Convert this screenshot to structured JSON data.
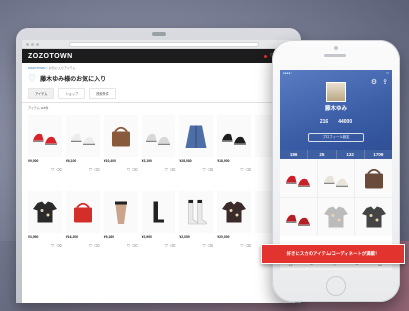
{
  "browser": {
    "address": ""
  },
  "site": {
    "logo": "ZOZOTOWN",
    "header_user": "",
    "breadcrumb_home": "ZOZOTOWN",
    "breadcrumb_current": "> お気に入りアイテム",
    "page_title": "藤木ゆみ様のお気に入り",
    "tabs": [
      {
        "label": "アイテム"
      },
      {
        "label": "ショップ"
      },
      {
        "label": "検索条件"
      }
    ],
    "tab_link": "",
    "filters": {
      "count_label": "アイテム 118件",
      "sort": "",
      "shop": "",
      "category": "",
      "price": "",
      "stock": ""
    }
  },
  "products": [
    {
      "price": "¥9,000",
      "meta": "",
      "shape": "shoes",
      "color": "#d9232a"
    },
    {
      "price": "¥6,100",
      "meta": "",
      "shape": "shoes",
      "color": "#ededed"
    },
    {
      "price": "¥10,400",
      "meta": "",
      "shape": "bag",
      "color": "#8a5a3c"
    },
    {
      "price": "¥3,190",
      "meta": "",
      "shape": "shoes",
      "color": "#d8d8d8"
    },
    {
      "price": "¥28,080",
      "meta": "",
      "shape": "coat",
      "color": "#4d6fa6"
    },
    {
      "price": "¥18,900",
      "meta": "",
      "shape": "shoes",
      "color": "#1d1d1d"
    },
    {
      "price": "",
      "meta": "",
      "shape": "none",
      "color": "#ffffff"
    },
    {
      "price": "¥3,990",
      "meta": "",
      "shape": "top",
      "color": "#2a2a2a"
    },
    {
      "price": "¥16,200",
      "meta": "",
      "shape": "bag",
      "color": "#d42e2b"
    },
    {
      "price": "¥9,180",
      "meta": "",
      "shape": "skirt",
      "color": "#caa48b"
    },
    {
      "price": "¥2,990",
      "meta": "",
      "shape": "boots",
      "color": "#222222"
    },
    {
      "price": "¥2,050",
      "meta": "",
      "shape": "socks",
      "color": "#e9e9e9"
    },
    {
      "price": "¥20,000",
      "meta": "",
      "shape": "top",
      "color": "#3a2a2a"
    },
    {
      "price": "",
      "meta": "",
      "shape": "none",
      "color": "#ffffff"
    }
  ],
  "phone": {
    "username": "藤木ゆみ",
    "subinfo": "",
    "stats": [
      {
        "value": "216",
        "label": ""
      },
      {
        "value": "44000",
        "label": ""
      }
    ],
    "profile_button": "プロフィール設定",
    "counts": [
      {
        "value": "186",
        "label": ""
      },
      {
        "value": "25",
        "label": ""
      },
      {
        "value": "132",
        "label": ""
      },
      {
        "value": "1709",
        "label": ""
      }
    ],
    "tiles": [
      {
        "shape": "shoes",
        "color": "#c91f26"
      },
      {
        "shape": "shoes",
        "color": "#e9e4da"
      },
      {
        "shape": "bag",
        "color": "#6a4a3a"
      },
      {
        "shape": "shoes",
        "color": "#b51e24"
      },
      {
        "shape": "top",
        "color": "#bbb"
      },
      {
        "shape": "top",
        "color": "#444"
      }
    ]
  },
  "banner": {
    "text": "好きにスカのアイテム/コーディネートが満載！"
  }
}
